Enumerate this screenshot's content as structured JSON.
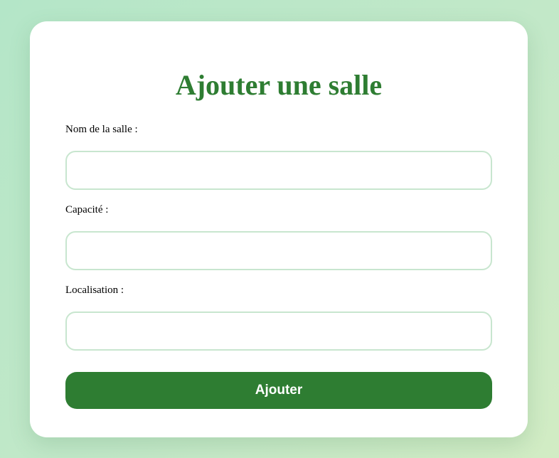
{
  "form": {
    "title": "Ajouter une salle",
    "fields": [
      {
        "label": "Nom de la salle :",
        "value": "",
        "placeholder": ""
      },
      {
        "label": "Capacité :",
        "value": "",
        "placeholder": ""
      },
      {
        "label": "Localisation :",
        "value": "",
        "placeholder": ""
      }
    ],
    "submit_label": "Ajouter"
  },
  "colors": {
    "accent": "#2e7d32",
    "input_border": "#c8e6cf",
    "card_background": "#ffffff",
    "page_background_start": "#b4e6c8",
    "page_background_end": "#d2ecc4"
  }
}
